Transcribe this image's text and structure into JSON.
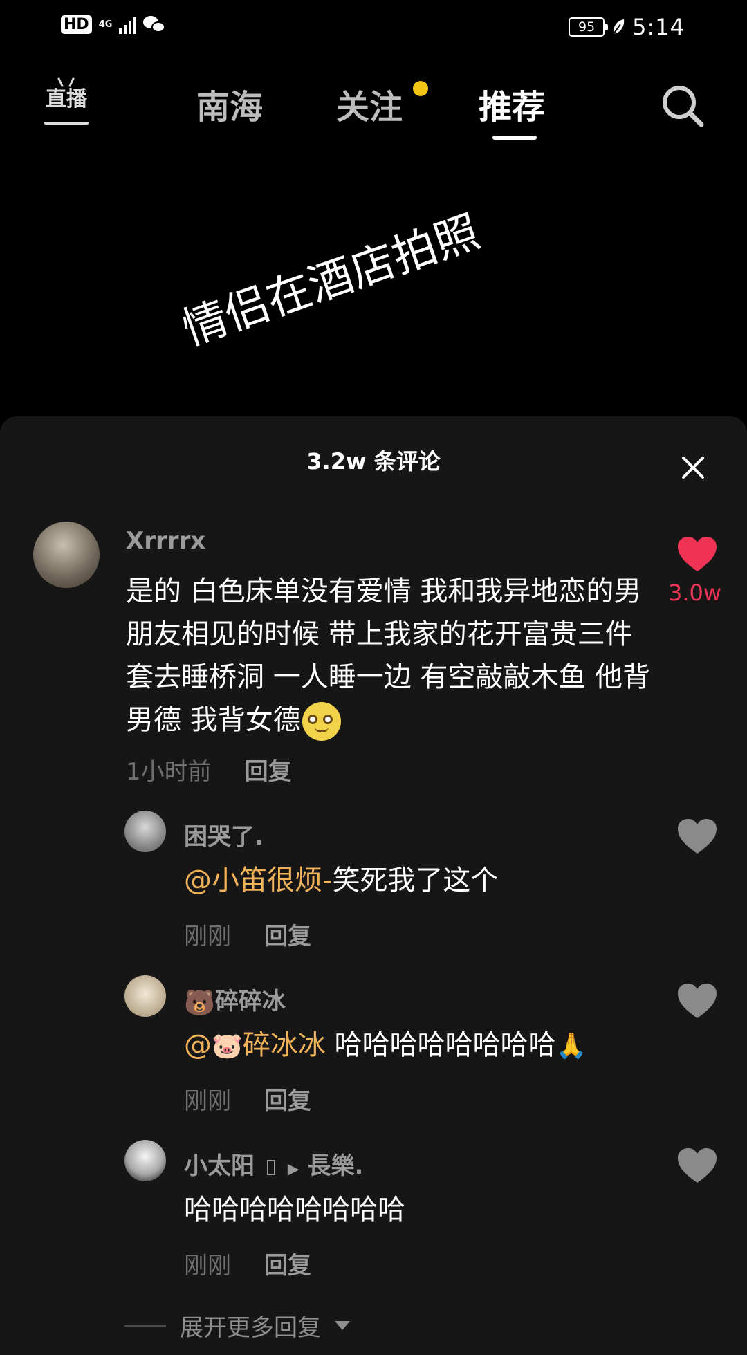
{
  "status_bar": {
    "hd": "HD",
    "network": "4G",
    "battery": "95",
    "time": "5:14"
  },
  "nav": {
    "live_label": "直播",
    "tabs": [
      {
        "label": "南海",
        "active": false
      },
      {
        "label": "关注",
        "active": false,
        "has_dot": true
      },
      {
        "label": "推荐",
        "active": true
      }
    ]
  },
  "video": {
    "overlay_text": "情侣在酒店拍照"
  },
  "comments_panel": {
    "title": "3.2w 条评论",
    "top_comment": {
      "username": "Xrrrrx",
      "text": "是的 白色床单没有爱情 我和我异地恋的男朋友相见的时候 带上我家的花开富贵三件套去睡桥洞 一人睡一边 有空敲敲木鱼 他背男德 我背女德",
      "emoji": "😳",
      "time": "1小时前",
      "reply_label": "回复",
      "likes": "3.0w",
      "liked": true
    },
    "replies": [
      {
        "username": "困哭了.",
        "mention": "@小笛很烦-",
        "text": "笑死我了这个",
        "time": "刚刚",
        "reply_label": "回复"
      },
      {
        "username_emoji": "🐻",
        "username": "碎碎冰",
        "mention_prefix": "@",
        "mention_emoji": "🐷",
        "mention": "碎冰冰",
        "text": "哈哈哈哈哈哈哈哈",
        "text_emoji": "🙏",
        "time": "刚刚",
        "reply_label": "回复"
      },
      {
        "username": "小太阳",
        "reply_arrow": "▶",
        "reply_to": "長樂.",
        "text": "哈哈哈哈哈哈哈哈",
        "time": "刚刚",
        "reply_label": "回复"
      }
    ],
    "expand_label": "展开更多回复"
  },
  "colors": {
    "accent_like": "#ee3355",
    "mention": "#f0b35a",
    "dot": "#f5c518",
    "panel_bg": "#161616"
  }
}
